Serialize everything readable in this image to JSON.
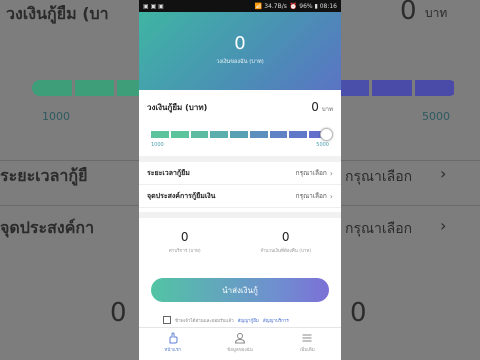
{
  "background": {
    "top_title": "วงเงินกู้ยืม (บา",
    "top_amount": "0",
    "top_unit": "บาท",
    "range_min": "1000",
    "range_max": "5000",
    "row1_label": "ระยะเวลากู้ยื",
    "row1_value": "กรุณาเลือก",
    "row2_label": "จุดประสงค์กา",
    "row2_value": "กรุณาเลือก",
    "bottom_left_amount": "0",
    "bottom_right_amount": "0",
    "bar_colors": [
      "#3f9e7a",
      "#3f9e7a",
      "#3f9e7a",
      "#4a8d88",
      "#4a7f96",
      "#4d6fa3",
      "#4a5aa8",
      "#4a50aa",
      "#4a4aa8",
      "#4a4aa8"
    ]
  },
  "status_bar": {
    "left": "▣ ▣ ▣",
    "signal": "📶 34.7B/s",
    "right": "⏰ 96% ▮ 08:16"
  },
  "hero": {
    "amount": "0",
    "subtitle": "วงเงินของฉัน (บาท)"
  },
  "loan": {
    "label": "วงเงินกู้ยืม (บาท)",
    "amount": "0",
    "unit": "บาท",
    "min": "1000",
    "max": "5000",
    "segment_colors": [
      "#5cc49c",
      "#5cc49c",
      "#5cbba0",
      "#5aaeac",
      "#5aa0b4",
      "#5c8fbd",
      "#5e82c4",
      "#6078c8",
      "#6270cc"
    ]
  },
  "period": {
    "label": "ระยะเวลากู้ยืม",
    "value": "กรุณาเลือก"
  },
  "purpose": {
    "label": "จุดประสงค์การกู้ยืมเงิน",
    "value": "กรุณาเลือก"
  },
  "stats": {
    "fee_value": "0",
    "fee_caption": "ค่าบริการ (บาท)",
    "repay_value": "0",
    "repay_caption": "จำนวนเงินที่ต้องคืน (บาท)"
  },
  "submit_label": "นำส่งเงินกู้",
  "agreement": {
    "text": "ข้าพเจ้าได้อ่านและยอมรับแล้ว",
    "link1": "สัญญากู้ยืม",
    "link2": "สัญญาบริการ"
  },
  "tabs": [
    {
      "label": "หน้าแรก",
      "icon": "hand-icon"
    },
    {
      "label": "ข้อมูลของฉัน",
      "icon": "user-icon"
    },
    {
      "label": "เพิ่มเติม",
      "icon": "menu-icon"
    }
  ],
  "colors": {
    "accent_blue": "#5b7fd0",
    "accent_green": "#52c4a4"
  }
}
